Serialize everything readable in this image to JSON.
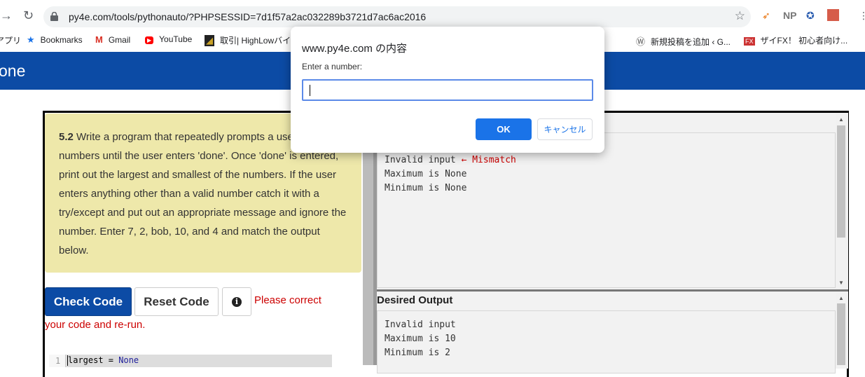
{
  "browser": {
    "url": "py4e.com/tools/pythonauto/?PHPSESSID=7d1f57a2ac032289b3721d7ac6ac2016",
    "extensions": [
      "NP"
    ]
  },
  "bookmarks": [
    {
      "label": "アプリ",
      "icon": "apps-grid-icon"
    },
    {
      "label": "Bookmarks",
      "icon": "star-icon"
    },
    {
      "label": "Gmail",
      "icon": "gmail-icon"
    },
    {
      "label": "YouTube",
      "icon": "youtube-icon"
    },
    {
      "label": "取引| HighLowバイナ",
      "icon": "highlow-icon"
    },
    {
      "label": "新規投稿を追加 ‹ G...",
      "icon": "wordpress-icon"
    },
    {
      "label": "ザイFX！ 初心者向け...",
      "icon": "zaifx-icon"
    }
  ],
  "header": {
    "title": "one"
  },
  "description": {
    "number": "5.2",
    "text": "Write a program that repeatedly prompts a user for integer numbers until the user enters 'done'. Once 'done' is entered, print out the largest and smallest of the numbers. If the user enters anything other than a valid number catch it with a try/except and put out an appropriate message and ignore the number. Enter 7, 2, bob, 10, and 4 and match the output below."
  },
  "buttons": {
    "check": "Check Code",
    "reset": "Reset Code",
    "info": "i"
  },
  "error": {
    "line1": "Please correct",
    "line2": "your code and re-run."
  },
  "editor": {
    "line_number": "1",
    "code_var": "largest = ",
    "code_kw": "None"
  },
  "output": {
    "lines": [
      "Invalid input",
      "Maximum is None",
      "Minimum is None"
    ],
    "mismatch": "← Mismatch"
  },
  "desired": {
    "title": "Desired Output",
    "lines": [
      "Invalid input",
      "Maximum is 10",
      "Minimum is 2"
    ]
  },
  "dialog": {
    "host": "www.py4e.com の内容",
    "message": "Enter a number:",
    "input_value": "",
    "ok": "OK",
    "cancel": "キャンセル"
  }
}
